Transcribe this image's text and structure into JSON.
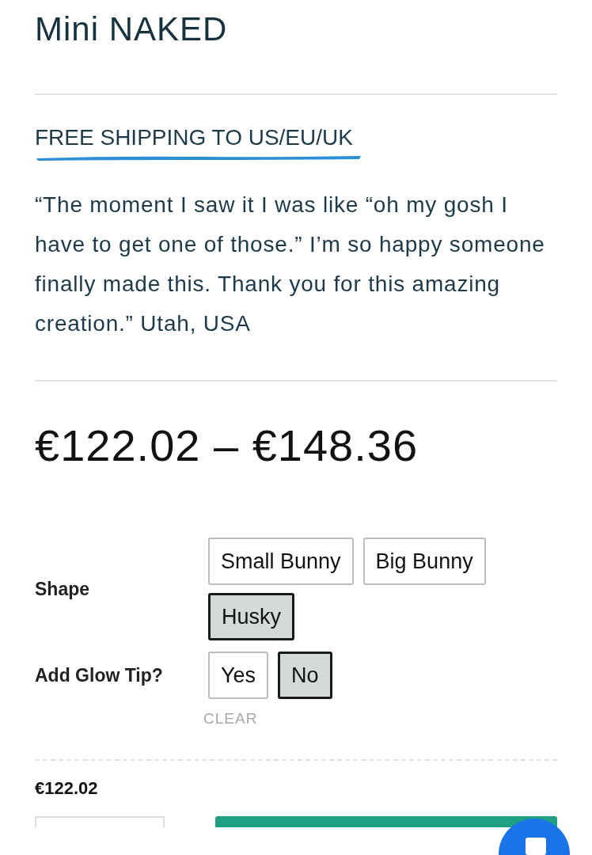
{
  "product": {
    "title": "Mini NAKED"
  },
  "shipping_banner": "FREE SHIPPING TO US/EU/UK",
  "testimonial": "“The moment I saw it I was like “oh my gosh I have to get one of those.” I’m so happy someone finally made this. Thank you for this amazing creation.” Utah, USA",
  "price_range": "€122.02 – €148.36",
  "options": [
    {
      "label": "Shape",
      "choices": [
        {
          "label": "Small Bunny",
          "selected": false
        },
        {
          "label": "Big Bunny",
          "selected": false
        },
        {
          "label": "Husky",
          "selected": true
        }
      ]
    },
    {
      "label": "Add Glow Tip?",
      "choices": [
        {
          "label": "Yes",
          "selected": false
        },
        {
          "label": "No",
          "selected": true
        }
      ]
    }
  ],
  "clear_link": "CLEAR",
  "variant_price": "€122.02"
}
